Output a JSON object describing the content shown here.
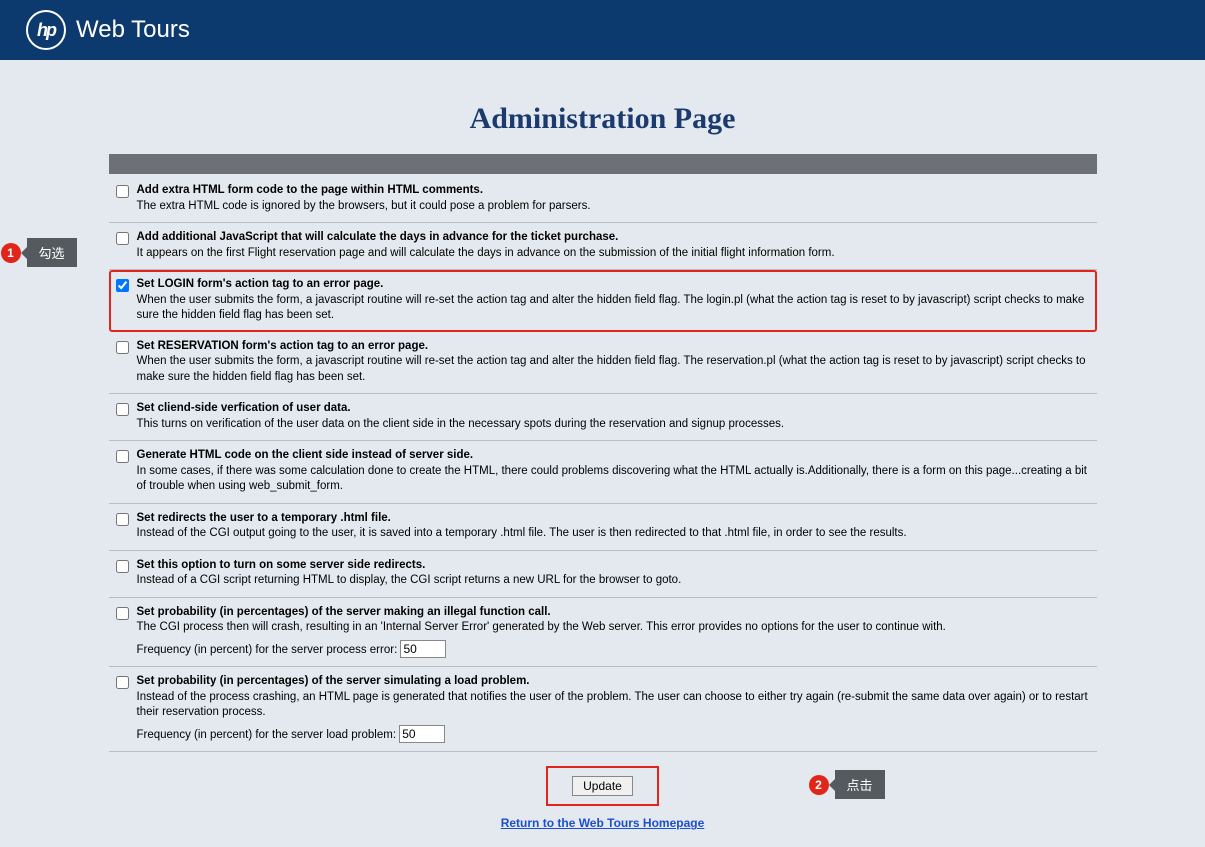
{
  "brand": "Web Tours",
  "page_title": "Administration Page",
  "options": [
    {
      "checked": false,
      "highlighted": false,
      "title": "Add extra HTML form code to the page within HTML comments.",
      "desc": "The extra HTML code is ignored by the browsers, but it could pose a problem for parsers."
    },
    {
      "checked": false,
      "highlighted": false,
      "title": "Add additional JavaScript that will calculate the days in advance for the ticket purchase.",
      "desc": "It appears on the first Flight reservation page and will calculate the days in advance on the submission of the initial flight information form."
    },
    {
      "checked": true,
      "highlighted": true,
      "title": "Set LOGIN form's action tag to an error page.",
      "desc": "When the user submits the form, a javascript routine will re-set the action tag and alter the hidden field flag. The login.pl (what the action tag is reset to by javascript) script checks to make sure the hidden field flag has been set."
    },
    {
      "checked": false,
      "highlighted": false,
      "title": "Set RESERVATION form's action tag to an error page.",
      "desc": "When the user submits the form, a javascript routine will re-set the action tag and alter the hidden field flag. The reservation.pl (what the action tag is reset to by javascript) script checks to make sure the hidden field flag has been set."
    },
    {
      "checked": false,
      "highlighted": false,
      "title": "Set cliend-side verfication of user data.",
      "desc": "This turns on verification of the user data on the client side in the necessary spots during the reservation and signup processes."
    },
    {
      "checked": false,
      "highlighted": false,
      "title": "Generate HTML code on the client side instead of server side.",
      "desc": "In some cases, if there was some calculation done to create the HTML, there could problems discovering what the HTML actually is.Additionally, there is a form on this page...creating a bit of trouble when using web_submit_form."
    },
    {
      "checked": false,
      "highlighted": false,
      "title": "Set redirects the user to a temporary .html file.",
      "desc": "Instead of the CGI output going to the user, it is saved into a temporary .html file. The user is then redirected to that .html file, in order to see the results."
    },
    {
      "checked": false,
      "highlighted": false,
      "title": "Set this option to turn on some server side redirects.",
      "desc": "Instead of a CGI script returning HTML to display, the CGI script returns a new URL for the browser to goto."
    },
    {
      "checked": false,
      "highlighted": false,
      "title": "Set probability (in percentages) of the server making an illegal function call.",
      "desc": "The CGI process then will crash, resulting in an 'Internal Server Error' generated by the Web server. This error provides no options for the user to continue with.",
      "freq_label": "Frequency (in percent) for the server process error: ",
      "freq_value": "50"
    },
    {
      "checked": false,
      "highlighted": false,
      "title": "Set probability (in percentages) of the server simulating a load problem.",
      "desc": "Instead of the process crashing, an HTML page is generated that notifies the user of the problem. The user can choose to either try again (re-submit the same data over again) or to restart their reservation process.",
      "freq_label": "Frequency (in percent) for the server load problem: ",
      "freq_value": "50"
    }
  ],
  "update_label": "Update",
  "return_link": "Return to the Web Tours Homepage",
  "annotations": {
    "a1_num": "1",
    "a1_text": " 勾选",
    "a2_num": "2",
    "a2_text": " 点击"
  }
}
